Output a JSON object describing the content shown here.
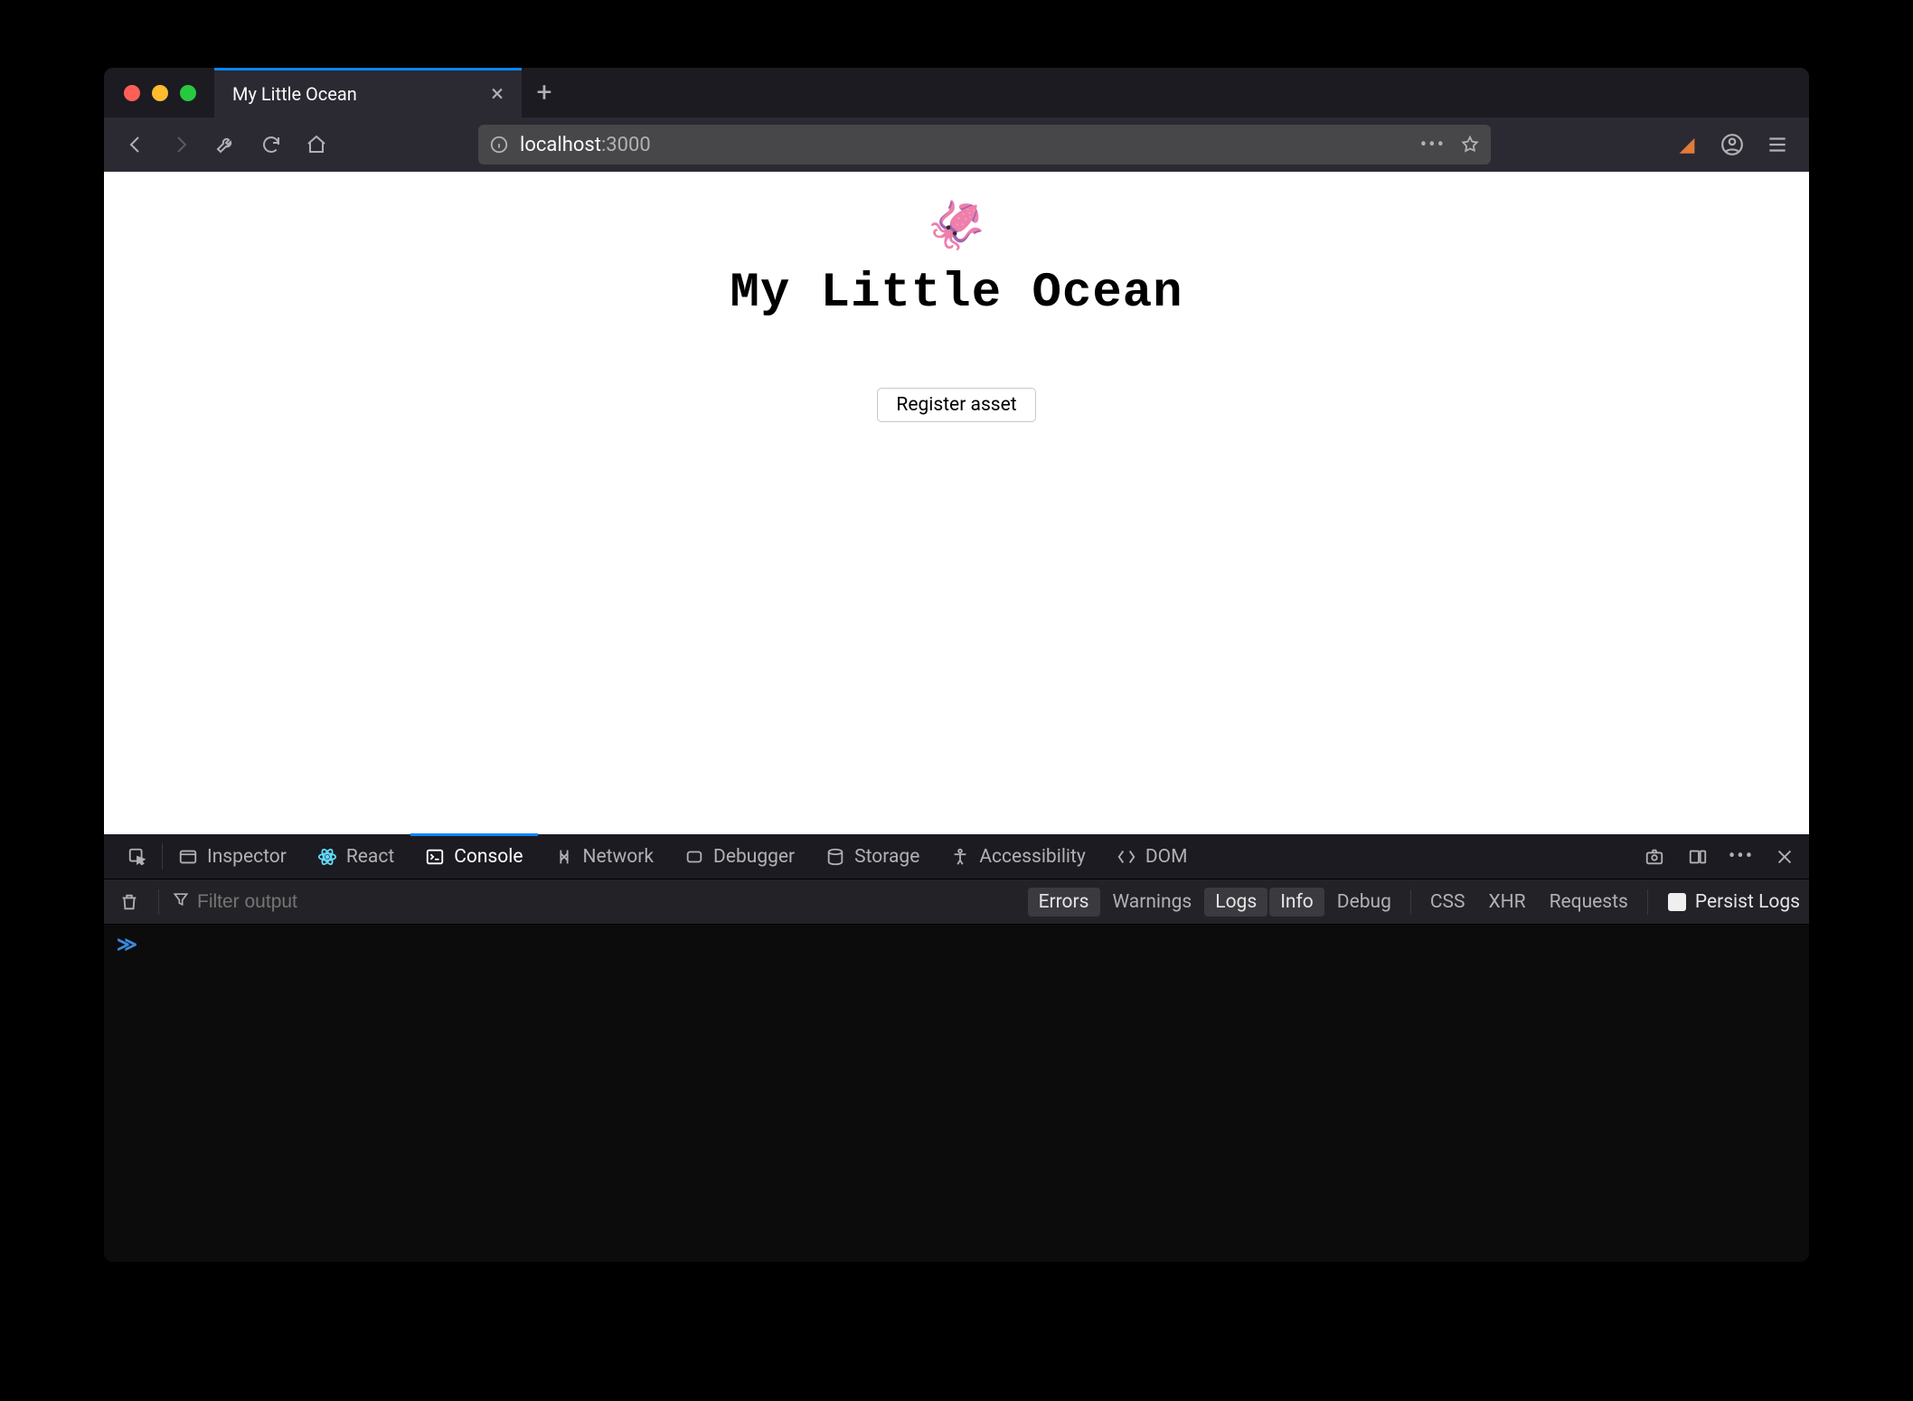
{
  "tab": {
    "title": "My Little Ocean"
  },
  "url": {
    "host": "localhost",
    "port": ":3000"
  },
  "app": {
    "logo_emoji": "🦑",
    "heading": "My Little Ocean",
    "register_button": "Register asset"
  },
  "devtools": {
    "tabs": {
      "inspector": "Inspector",
      "react": "React",
      "console": "Console",
      "network": "Network",
      "debugger": "Debugger",
      "storage": "Storage",
      "accessibility": "Accessibility",
      "dom": "DOM"
    },
    "filter_placeholder": "Filter output",
    "levels": {
      "errors": "Errors",
      "warnings": "Warnings",
      "logs": "Logs",
      "info": "Info",
      "debug": "Debug"
    },
    "categories": {
      "css": "CSS",
      "xhr": "XHR",
      "requests": "Requests"
    },
    "persist_label": "Persist Logs",
    "prompt": "≫"
  }
}
